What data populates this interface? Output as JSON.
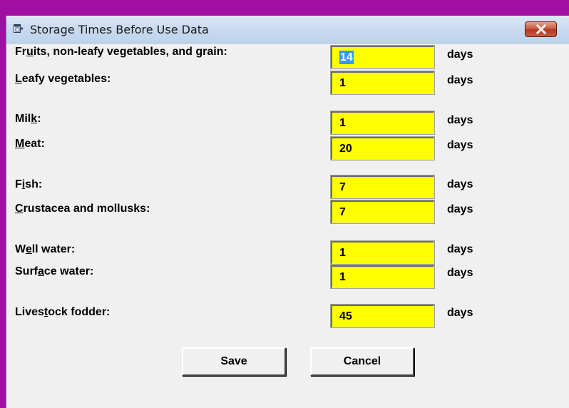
{
  "window": {
    "title": "Storage Times Before Use Data",
    "close_icon": "close-icon",
    "app_icon": "window-icon"
  },
  "fields": [
    {
      "label_pre": "Fr",
      "label_acc": "u",
      "label_post": "its, non-leafy vegetables, and grain:",
      "value": "14",
      "unit": "days"
    },
    {
      "label_pre": "",
      "label_acc": "L",
      "label_post": "eafy vegetables:",
      "value": "1",
      "unit": "days"
    },
    {
      "label_pre": "Mil",
      "label_acc": "k",
      "label_post": ":",
      "value": "1",
      "unit": "days"
    },
    {
      "label_pre": "",
      "label_acc": "M",
      "label_post": "eat:",
      "value": "20",
      "unit": "days"
    },
    {
      "label_pre": "F",
      "label_acc": "i",
      "label_post": "sh:",
      "value": "7",
      "unit": "days"
    },
    {
      "label_pre": "",
      "label_acc": "C",
      "label_post": "rustacea and mollusks:",
      "value": "7",
      "unit": "days"
    },
    {
      "label_pre": "W",
      "label_acc": "e",
      "label_post": "ll water:",
      "value": "1",
      "unit": "days"
    },
    {
      "label_pre": "Surf",
      "label_acc": "a",
      "label_post": "ce water:",
      "value": "1",
      "unit": "days"
    },
    {
      "label_pre": "Lives",
      "label_acc": "t",
      "label_post": "ock fodder:",
      "value": "45",
      "unit": "days"
    }
  ],
  "buttons": {
    "save": "Save",
    "cancel": "Cancel"
  },
  "colors": {
    "field_bg": "#ffff00",
    "selection": "#3399ff",
    "frame": "#a40fa3",
    "close_button": "#c9553b"
  }
}
